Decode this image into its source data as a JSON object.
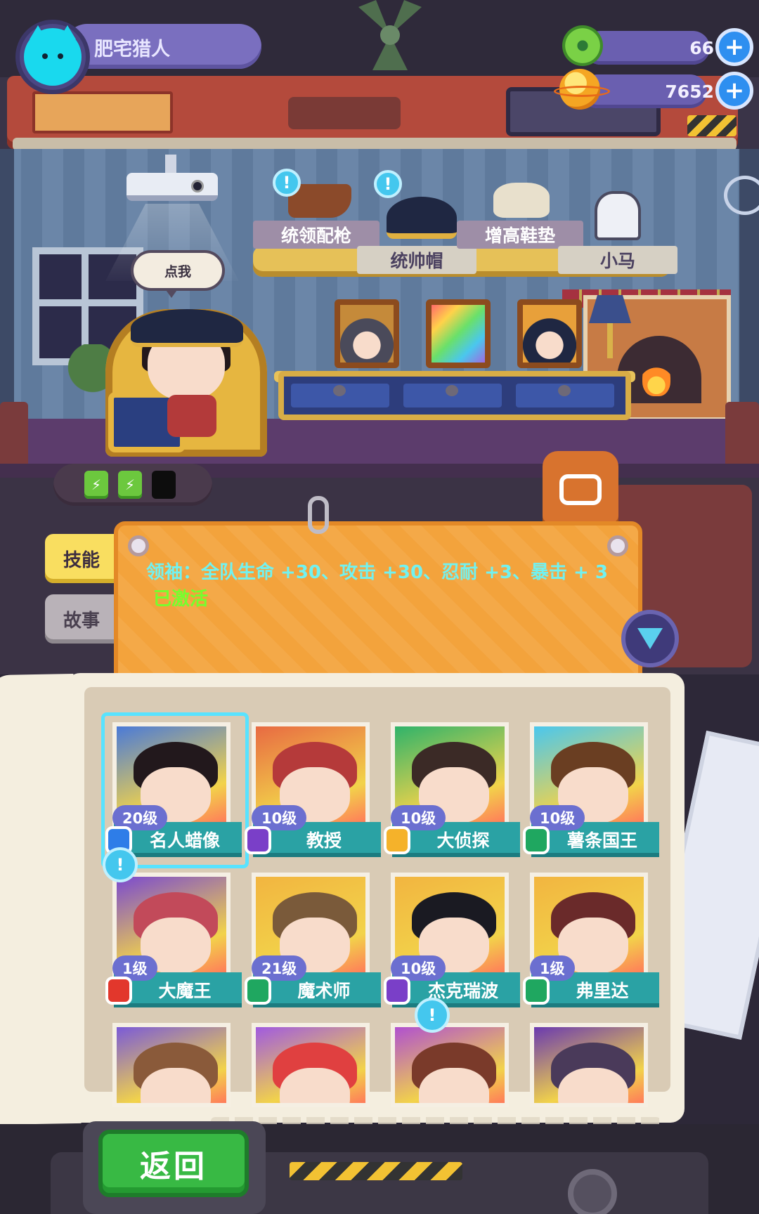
{
  "player": {
    "name": "肥宅猎人"
  },
  "currencies": {
    "donut": {
      "amount": "66",
      "icon": "donut-icon"
    },
    "gold": {
      "amount": "7652",
      "icon": "gold-planet-icon"
    }
  },
  "speech": "点我",
  "items": [
    {
      "label": "统领配枪",
      "icon": "pistol-icon",
      "alert": true
    },
    {
      "label": "统帅帽",
      "icon": "bicorne-hat-icon",
      "alert": true
    },
    {
      "label": "增高鞋垫",
      "icon": "insole-icon",
      "alert": false
    },
    {
      "label": "小马",
      "icon": "pony-icon",
      "alert": false
    }
  ],
  "alert_symbol": "!",
  "energy": {
    "full": 2,
    "total": 3
  },
  "tabs": {
    "skill": "技能",
    "story": "故事"
  },
  "skill": {
    "text": "领袖：全队生命 +30、攻击 +30、忍耐 +3、暴击 + 3",
    "status": "已激活"
  },
  "characters": [
    {
      "level": "20级",
      "name": "名人蜡像",
      "rank": "blue",
      "hair": "#22181c",
      "bg": "#4a7ad8",
      "selected": true
    },
    {
      "level": "10级",
      "name": "教授",
      "rank": "purple",
      "hair": "#b53a3a",
      "bg": "#e86a42"
    },
    {
      "level": "10级",
      "name": "大侦探",
      "rank": "gold",
      "hair": "#3b2a26",
      "bg": "#2fb36a"
    },
    {
      "level": "10级",
      "name": "薯条国王",
      "rank": "green",
      "hair": "#6a3e22",
      "bg": "#4ac7ee"
    },
    {
      "level": "1级",
      "name": "大魔王",
      "rank": "red",
      "hair": "#c24a5a",
      "bg": "#7a4ad0",
      "alert": true
    },
    {
      "level": "21级",
      "name": "魔术师",
      "rank": "green",
      "hair": "#7a5a3a",
      "bg": "#f2b540"
    },
    {
      "level": "10级",
      "name": "杰克瑞波",
      "rank": "purple",
      "hair": "#1a1a22",
      "bg": "#f2b540"
    },
    {
      "level": "1级",
      "name": "弗里达",
      "rank": "green",
      "hair": "#6a2a2a",
      "bg": "#f2b540"
    },
    {
      "level": "",
      "name": "",
      "rank": "",
      "hair": "#8a5a3a",
      "bg": "#7a5ad8"
    },
    {
      "level": "",
      "name": "",
      "rank": "",
      "hair": "#e04040",
      "bg": "#a05ae0"
    },
    {
      "level": "",
      "name": "",
      "rank": "",
      "hair": "#7a3a2a",
      "bg": "#b050d0",
      "alert": true
    },
    {
      "level": "",
      "name": "",
      "rank": "",
      "hair": "#4a3a5a",
      "bg": "#6a3ab0"
    }
  ],
  "back_button": "返回"
}
